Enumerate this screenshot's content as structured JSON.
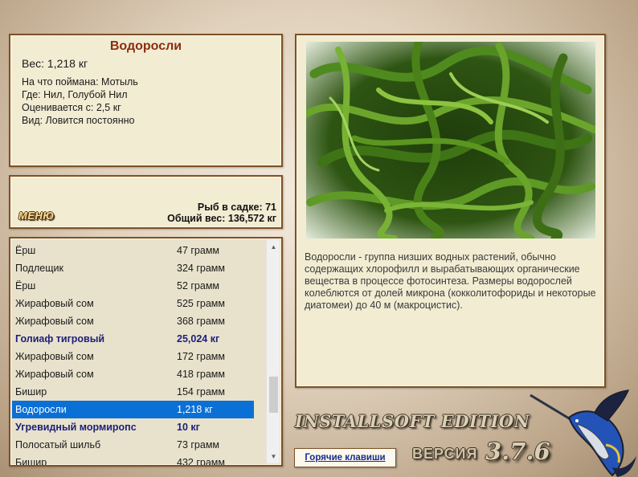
{
  "info": {
    "title": "Водоросли",
    "weight": "Вес: 1,218 кг",
    "bait": "На что поймана: Мотыль",
    "location": "Где: Нил, Голубой Нил",
    "valued_from": "Оценивается с: 2,5 кг",
    "type": "Вид: Ловится постоянно"
  },
  "stats": {
    "menu_label": "МЕНЮ",
    "fish_in_net": "Рыб в садке: 71",
    "total_weight": "Общий вес: 136,572 кг"
  },
  "catch_list": [
    {
      "name": "Ёрш",
      "weight": "47 грамм",
      "bold": false,
      "selected": false
    },
    {
      "name": "Подлещик",
      "weight": "324 грамм",
      "bold": false,
      "selected": false
    },
    {
      "name": "Ёрш",
      "weight": "52 грамм",
      "bold": false,
      "selected": false
    },
    {
      "name": "Жирафовый сом",
      "weight": "525 грамм",
      "bold": false,
      "selected": false
    },
    {
      "name": "Жирафовый сом",
      "weight": "368 грамм",
      "bold": false,
      "selected": false
    },
    {
      "name": "Голиаф тигровый",
      "weight": "25,024 кг",
      "bold": true,
      "selected": false
    },
    {
      "name": "Жирафовый сом",
      "weight": "172 грамм",
      "bold": false,
      "selected": false
    },
    {
      "name": "Жирафовый сом",
      "weight": "418 грамм",
      "bold": false,
      "selected": false
    },
    {
      "name": "Бишир",
      "weight": "154 грамм",
      "bold": false,
      "selected": false
    },
    {
      "name": "Водоросли",
      "weight": "1,218 кг",
      "bold": false,
      "selected": true
    },
    {
      "name": "Угревидный мормиропс",
      "weight": "10 кг",
      "bold": true,
      "selected": false
    },
    {
      "name": "Полосатый шильб",
      "weight": "73 грамм",
      "bold": false,
      "selected": false
    },
    {
      "name": "Бишир",
      "weight": "432 грамм",
      "bold": false,
      "selected": false
    }
  ],
  "scrollbar": {
    "up_icon": "triangle-up-icon",
    "down_icon": "triangle-down-icon"
  },
  "photo": {
    "subject": "seaweed-photo"
  },
  "description": "Водоросли - группа низших водных растений, обычно содержащих хлорофилл и вырабатывающих органические вещества в процессе фотосинтеза. Размеры водорослей колеблются от долей микрона (кокколитофориды и некоторые диатомеи) до 40 м (макроцистис).",
  "brand": {
    "edition": "INSTALLSOFT EDITION",
    "hotkeys_label": "Горячие клавиши",
    "version_label": "ВЕРСИЯ",
    "version_number": "3.7.6",
    "logo_icon": "marlin-logo-icon"
  },
  "colors": {
    "panel_bg": "#f2ecd3",
    "panel_border": "#7d5128",
    "title_red": "#8b2d0f",
    "bold_row_blue": "#1c1e7a",
    "selected_row": "#0a70d6"
  }
}
